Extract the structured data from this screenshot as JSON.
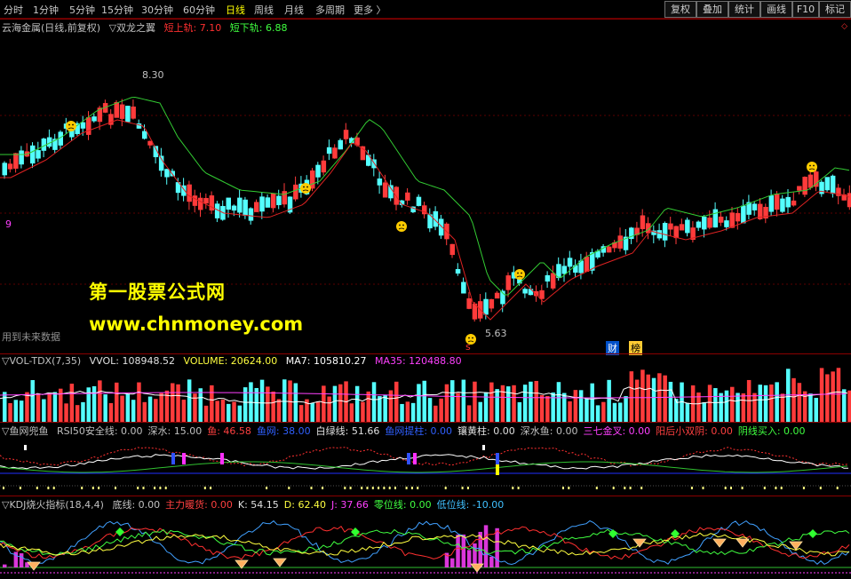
{
  "toolbar": {
    "periods": [
      "分时",
      "1分钟",
      "5分钟",
      "15分钟",
      "30分钟",
      "60分钟",
      "日线",
      "周线",
      "月线",
      "多周期",
      "更多 〉"
    ],
    "active_period": "日线",
    "buttons": [
      "复权",
      "叠加",
      "统计",
      "画线",
      "F10",
      "标记"
    ]
  },
  "main_pane": {
    "title": "云海金属(日线,前复权)",
    "indicator": "▽双龙之翼",
    "upper_label": "短上轨: 7.10",
    "lower_label": "短下轨: 6.88",
    "high_label": "8.30",
    "low_label": "5.63",
    "side_label": "9",
    "future_note": "用到未来数据",
    "watermark_title": "第一股票公式网",
    "watermark_url": "www.chnmoney.com",
    "cai_label": "财",
    "bang_label": "榜",
    "s_label": "s",
    "colors": {
      "up": "#ff3b3b",
      "down": "#54ffff",
      "upper_line": "#33cc33",
      "lower_line": "#dd2222"
    }
  },
  "vol_pane": {
    "name": "▽VOL-TDX(7,35)",
    "vvol": "VVOL: 108948.52",
    "volume": "VOLUME: 20624.00",
    "ma7": "MA7: 105810.27",
    "ma35": "MA35: 120488.80"
  },
  "fish_pane": {
    "name": "▽鱼网兜鱼",
    "items": [
      {
        "text": "RSI50安全线: 0.00",
        "color": "#c0c0c0"
      },
      {
        "text": "深水: 15.00",
        "color": "#c0c0c0"
      },
      {
        "text": "鱼: 46.58",
        "color": "#ff4040"
      },
      {
        "text": "鱼网: 38.00",
        "color": "#3060ff"
      },
      {
        "text": "白绿线: 51.66",
        "color": "#e0e0e0"
      },
      {
        "text": "鱼网提柱: 0.00",
        "color": "#3060ff"
      },
      {
        "text": "镶黄柱: 0.00",
        "color": "#e0e0e0"
      },
      {
        "text": "深水鱼: 0.00",
        "color": "#c0c0c0"
      },
      {
        "text": "三七金叉: 0.00",
        "color": "#ff40ff"
      },
      {
        "text": "阳后小双阴: 0.00",
        "color": "#ff4040"
      },
      {
        "text": "阴线买入: 0.00",
        "color": "#40ff40"
      }
    ]
  },
  "kdj_pane": {
    "name": "▽KDJ烧火指标(18,4,4)",
    "items": [
      {
        "text": "底线: 0.00",
        "color": "#c0c0c0"
      },
      {
        "text": "主力暖货: 0.00",
        "color": "#ff4040"
      },
      {
        "text": "K: 54.15",
        "color": "#e0e0e0"
      },
      {
        "text": "D: 62.40",
        "color": "#ffff40"
      },
      {
        "text": "J: 37.66",
        "color": "#ff40ff"
      },
      {
        "text": "零位线: 0.00",
        "color": "#40ff40"
      },
      {
        "text": "低位线: -10.00",
        "color": "#40c0ff"
      }
    ]
  }
}
